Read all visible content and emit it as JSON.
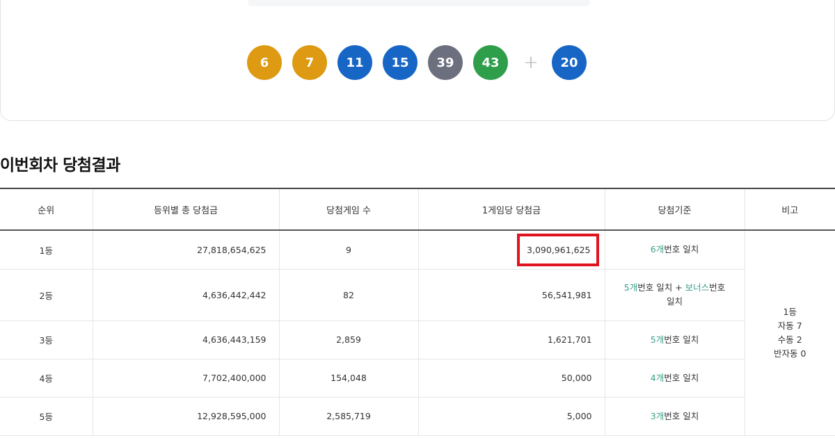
{
  "draw": {
    "date_text": "",
    "balls": [
      {
        "number": "6",
        "color": "#dd9a12"
      },
      {
        "number": "7",
        "color": "#dd9a12"
      },
      {
        "number": "11",
        "color": "#1766c6"
      },
      {
        "number": "15",
        "color": "#1766c6"
      },
      {
        "number": "39",
        "color": "#6c6f7d"
      },
      {
        "number": "43",
        "color": "#2e9e4a"
      }
    ],
    "plus": "+",
    "bonus": {
      "number": "20",
      "color": "#1766c6"
    }
  },
  "section_title": "이번회차 당첨결과",
  "table": {
    "headers": [
      "순위",
      "등위별 총 당첨금",
      "당첨게임 수",
      "1게임당 당첨금",
      "당첨기준",
      "비고"
    ],
    "rows": [
      {
        "rank": "1등",
        "total": "27,818,654,625",
        "games": "9",
        "per_game": "3,090,961,625"
      },
      {
        "rank": "2등",
        "total": "4,636,442,442",
        "games": "82",
        "per_game": "56,541,981"
      },
      {
        "rank": "3등",
        "total": "4,636,443,159",
        "games": "2,859",
        "per_game": "1,621,701"
      },
      {
        "rank": "4등",
        "total": "7,702,400,000",
        "games": "154,048",
        "per_game": "50,000"
      },
      {
        "rank": "5등",
        "total": "12,928,595,000",
        "games": "2,585,719",
        "per_game": "5,000"
      }
    ],
    "criteria": {
      "r1_a": "6개",
      "r1_b": "번호 일치",
      "r2_a": "5개",
      "r2_b": "번호 일치 + ",
      "r2_c": "보너스",
      "r2_d": "번호",
      "r2_e": "일치",
      "r3_a": "5개",
      "r3_b": "번호 일치",
      "r4_a": "4개",
      "r4_b": "번호 일치",
      "r5_a": "3개",
      "r5_b": "번호 일치"
    },
    "note": {
      "line1": "1등",
      "line2": "자동 7",
      "line3": "수동 2",
      "line4": "반자동 0"
    }
  },
  "colors": {
    "accent_green": "#3aa08a",
    "highlight_red": "#e0141e"
  }
}
